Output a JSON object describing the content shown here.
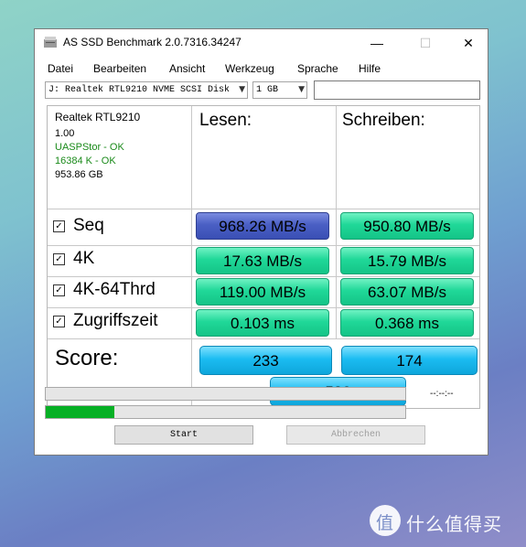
{
  "window": {
    "title": "AS SSD Benchmark 2.0.7316.34247",
    "minimize_glyph": "—",
    "maximize_glyph": "☐",
    "close_glyph": "✕"
  },
  "menu": [
    "Datei",
    "Bearbeiten",
    "Ansicht",
    "Werkzeug",
    "Sprache",
    "Hilfe"
  ],
  "toolbar": {
    "drive_select": "J: Realtek RTL9210 NVME SCSI Disk",
    "size_select": "1 GB",
    "text_field": ""
  },
  "drive_info": {
    "name": "Realtek RTL9210",
    "firmware": "1.00",
    "driver_status": "UASPStor - OK",
    "alignment_status": "16384 K - OK",
    "capacity": "953.86 GB"
  },
  "columns": {
    "read": "Lesen:",
    "write": "Schreiben:"
  },
  "rows": [
    {
      "label": "Seq",
      "checked": true,
      "read": "968.26 MB/s",
      "write": "950.80 MB/s"
    },
    {
      "label": "4K",
      "checked": true,
      "read": "17.63 MB/s",
      "write": "15.79 MB/s"
    },
    {
      "label": "4K-64Thrd",
      "checked": true,
      "read": "119.00 MB/s",
      "write": "63.07 MB/s"
    },
    {
      "label": "Zugriffszeit",
      "checked": true,
      "read": "0.103 ms",
      "write": "0.368 ms"
    }
  ],
  "score": {
    "label": "Score:",
    "read": "233",
    "write": "174",
    "total": "532"
  },
  "progress": {
    "top_fraction": 0.0,
    "bottom_fraction": 0.19,
    "time": "--:--:--"
  },
  "buttons": {
    "start": "Start",
    "cancel": "Abbrechen"
  },
  "colors": {
    "ok_text": "#1a8a1a",
    "green_cell": "#20d898",
    "blue_cell": "#4a5fc4",
    "score_cell": "#1bbcf1",
    "progress": "#06b025"
  },
  "watermark": {
    "text": "什么值得买",
    "logo_glyph": "值"
  }
}
